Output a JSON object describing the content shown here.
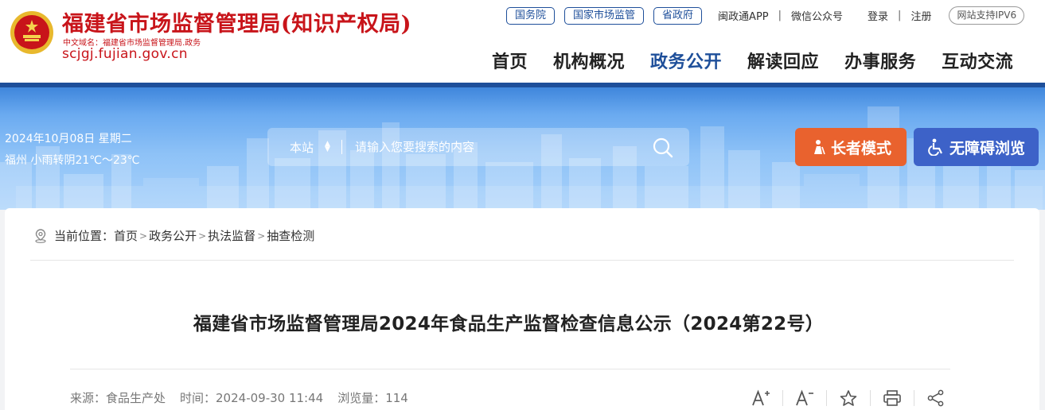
{
  "header": {
    "site_title": "福建省市场监督管理局(知识产权局)",
    "domain_cn": "中文域名：福建省市场监督管理局.政务",
    "domain_en": "scjgj.fujian.gov.cn",
    "top_links": {
      "pills": [
        "国务院",
        "国家市场监管",
        "省政府"
      ],
      "app": "闽政通APP",
      "wechat": "微信公众号",
      "login": "登录",
      "register": "注册",
      "ipv6": "网站支持IPV6"
    },
    "nav": [
      "首页",
      "机构概况",
      "政务公开",
      "解读回应",
      "办事服务",
      "互动交流"
    ],
    "nav_active": "政务公开"
  },
  "banner": {
    "date": "2024年10月08日 星期二",
    "weather": "福州 小雨转阴21℃～23℃",
    "search_scope": "本站",
    "search_placeholder": "请输入您要搜索的内容",
    "elder_mode": "长者模式",
    "accessible_mode": "无障碍浏览"
  },
  "breadcrumb": {
    "label": "当前位置：",
    "items": [
      "首页",
      "政务公开",
      "执法监督",
      "抽查检测"
    ]
  },
  "article": {
    "title": "福建省市场监督管理局2024年食品生产监督检查信息公示（2024第22号）",
    "source": "来源：食品生产处",
    "time": "时间：2024-09-30 11:44",
    "views": "浏览量：114"
  },
  "colors": {
    "brand_red": "#c8141a",
    "brand_blue": "#1e4f9a",
    "elder_orange": "#e9622e",
    "accessible_blue": "#3d62c8"
  },
  "icons": [
    "national-emblem-icon",
    "search-icon",
    "elder-icon",
    "wheelchair-icon",
    "location-icon",
    "font-increase-icon",
    "font-decrease-icon",
    "star-icon",
    "print-icon",
    "share-icon"
  ]
}
